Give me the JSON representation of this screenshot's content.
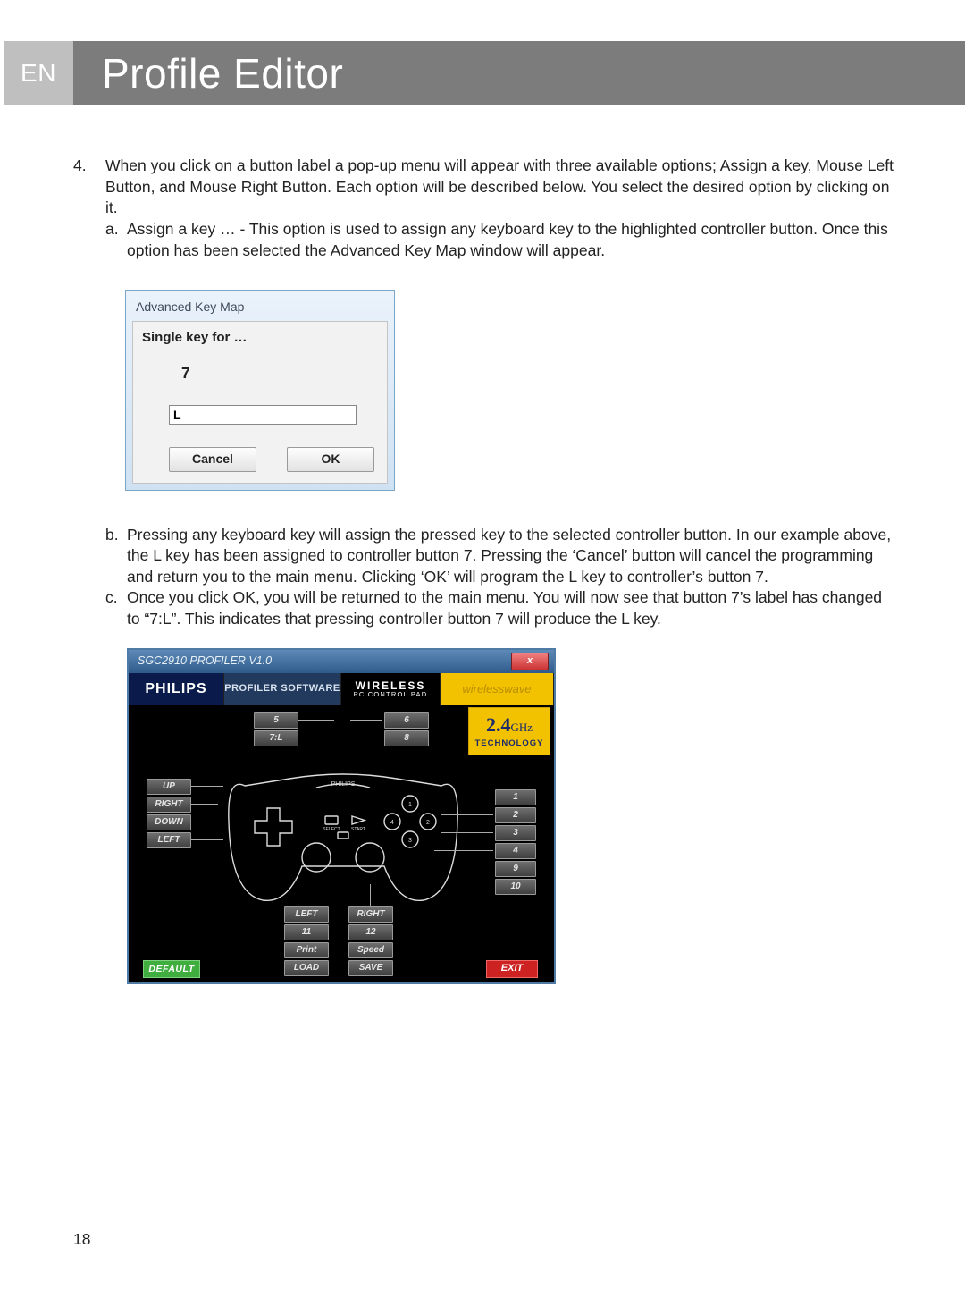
{
  "header": {
    "lang_tab": "EN",
    "title": "Profile Editor"
  },
  "para4": {
    "num": "4.",
    "text": "When you click on a button label a pop-up menu will appear with three available options; Assign a key, Mouse Left Button, and Mouse Right Button. Each option will be described below. You select the desired option by clicking on it."
  },
  "para4a": {
    "num": "a.",
    "text": "Assign a key … - This option is used to assign any keyboard key to the highlighted controller button. Once this option has been selected the Advanced Key Map window will appear."
  },
  "dialog1": {
    "title": "Advanced Key Map",
    "subtitle": "Single key for …",
    "button_num": "7",
    "input_value": "L",
    "cancel": "Cancel",
    "ok": "OK"
  },
  "para4b": {
    "num": "b.",
    "text": "Pressing any keyboard key will assign the pressed key to the selected controller button. In our example above, the L key has been assigned to controller button 7. Pressing the ‘Cancel’ button will cancel the programming and return you to the main menu. Clicking ‘OK’ will program the L key to controller’s button 7."
  },
  "para4c": {
    "num": "c.",
    "text": "Once you click OK, you will be returned to the main menu. You will now see that button 7’s label has changed to “7:L”. This indicates that pressing controller button 7 will produce the L key."
  },
  "profiler": {
    "titlebar": "SGC2910 PROFILER V1.0",
    "close": "x",
    "brand": "PHILIPS",
    "software_label": "PROFILER SOFTWARE",
    "wireless1": "WIRELESS",
    "wireless2": "PC CONTROL PAD",
    "wave": "wirelesswave",
    "ghz_big": "2.4",
    "ghz_unit": "GHz",
    "ghz_small": "TECHNOLOGY",
    "top_left1": "5",
    "top_left2": "7:L",
    "top_right1": "6",
    "top_right2": "8",
    "dpad_up": "UP",
    "dpad_right": "RIGHT",
    "dpad_down": "DOWN",
    "dpad_left": "LEFT",
    "side_1": "1",
    "side_2": "2",
    "side_3": "3",
    "side_4": "4",
    "side_9": "9",
    "side_10": "10",
    "stick_left": "LEFT",
    "stick_right": "RIGHT",
    "under_left": "11",
    "under_right": "12",
    "print": "Print",
    "speed": "Speed",
    "load": "LOAD",
    "save": "SAVE",
    "default": "DEFAULT",
    "exit": "EXIT",
    "pad_brand": "PHILIPS",
    "pad_select": "SELECT",
    "pad_start": "START",
    "pad_face1": "1",
    "pad_face2": "2",
    "pad_face3": "3",
    "pad_face4": "4"
  },
  "page_number": "18"
}
